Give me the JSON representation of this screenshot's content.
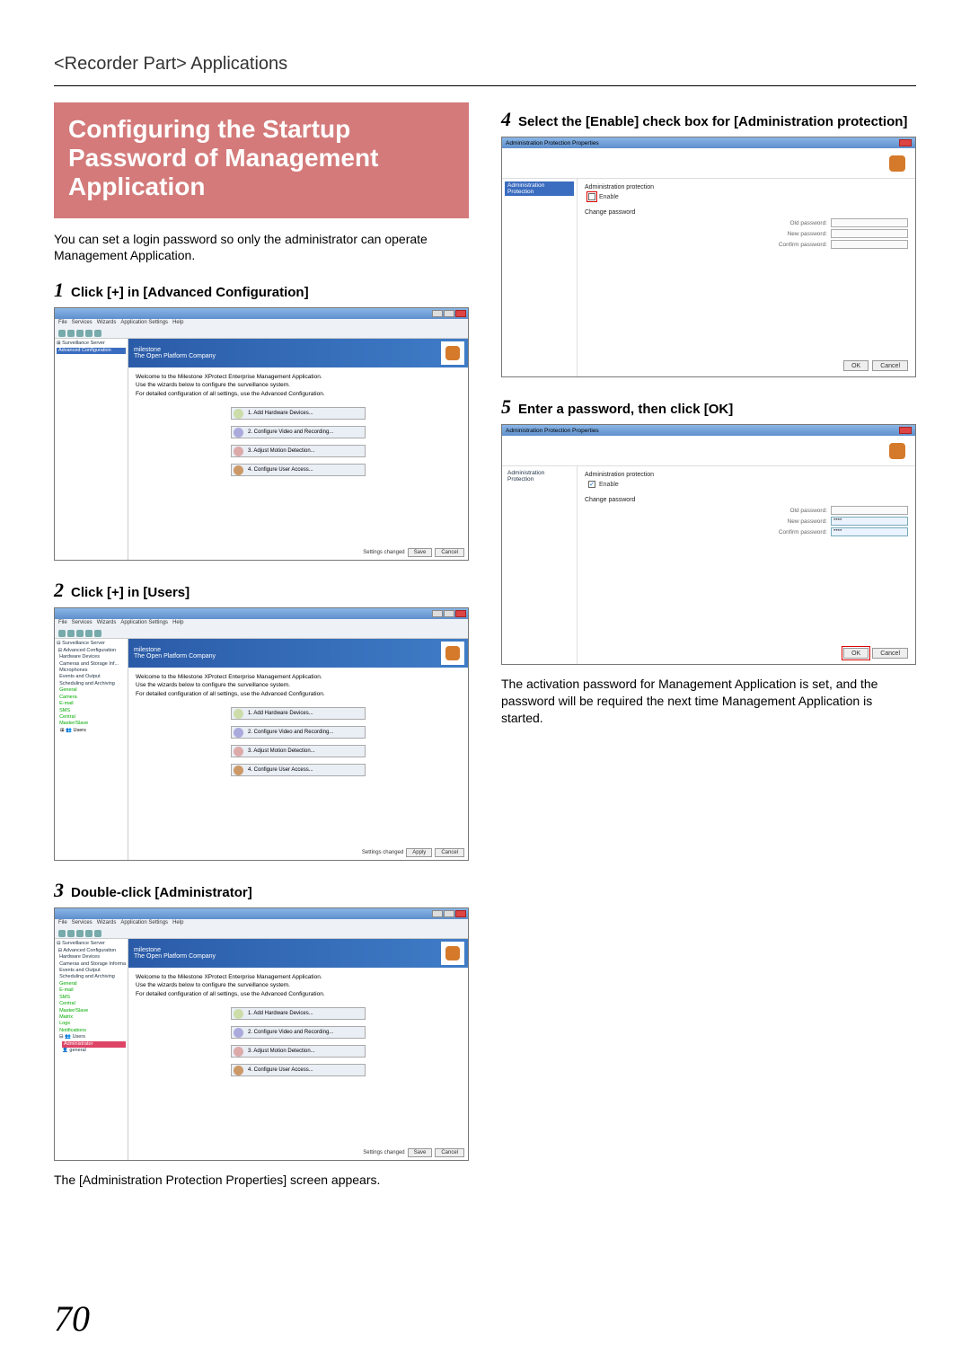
{
  "breadcrumb": "<Recorder Part> Applications",
  "title": "Configuring the Startup Password of Management Application",
  "intro": "You can set a login password so only the administrator can operate Management Application.",
  "steps": [
    {
      "num": "1",
      "text": "Click [+] in [Advanced Configuration]"
    },
    {
      "num": "2",
      "text": "Click [+] in [Users]"
    },
    {
      "num": "3",
      "text": "Double-click [Administrator]"
    },
    {
      "num": "4",
      "text": "Select the [Enable] check box for [Administration protection]"
    },
    {
      "num": "5",
      "text": "Enter a password, then click [OK]"
    }
  ],
  "caption3": "The [Administration Protection Properties] screen appears.",
  "caption5": "The activation password for Management Application is set, and the password will be required the next time Management Application is started.",
  "pagenum": "70",
  "ss": {
    "menu": [
      "File",
      "Services",
      "Wizards",
      "Application Settings",
      "Help"
    ],
    "bannerBrand": "milestone",
    "bannerTag": "The Open Platform Company",
    "welcome": "Welcome to the Milestone XProtect Enterprise Management Application.",
    "sub1": "Use the wizards below to configure the surveillance system.",
    "sub2": "For detailed configuration of all settings, use the Advanced Configuration.",
    "wiz": [
      "1. Add Hardware Devices...",
      "2. Configure Video and Recording...",
      "3. Adjust Motion Detection...",
      "4. Configure User Access..."
    ],
    "footerStatus": "Settings changed",
    "footerApply": "Apply",
    "footerCancel": "Cancel",
    "footerSave": "Save"
  },
  "tree1": {
    "selected": "Advanced Configuration"
  },
  "tree2": {
    "nodes": [
      "Surveillance Server",
      "Advanced Configuration",
      "Hardware Devices",
      "Cameras and Storage Inf...",
      "Microphones",
      "Events and Output",
      "Scheduling and Archiving",
      "General",
      "Camera",
      "E-mail",
      "SMS",
      "Central",
      "Master/Slave",
      "Users"
    ],
    "users": "Users"
  },
  "tree3": {
    "nodes": [
      "Surveillance Server",
      "Advanced Configuration",
      "Hardware Devices",
      "Cameras and Storage Information so...",
      "Events and Output",
      "Scheduling and Archiving",
      "General",
      "E-mail",
      "SMS",
      "Central",
      "Master/Slave",
      "Matrix",
      "Logs",
      "Notifications",
      "Users"
    ],
    "admin": "Administrator",
    "user2": "general"
  },
  "dlg": {
    "title": "Administration Protection Properties",
    "sideNode": "Administration Protection",
    "sectionProt": "Administration protection",
    "enable": "Enable",
    "sectionPw": "Change password",
    "old": "Old password:",
    "new": "New password:",
    "confirm": "Confirm password:",
    "mask": "****",
    "ok": "OK",
    "cancel": "Cancel"
  }
}
